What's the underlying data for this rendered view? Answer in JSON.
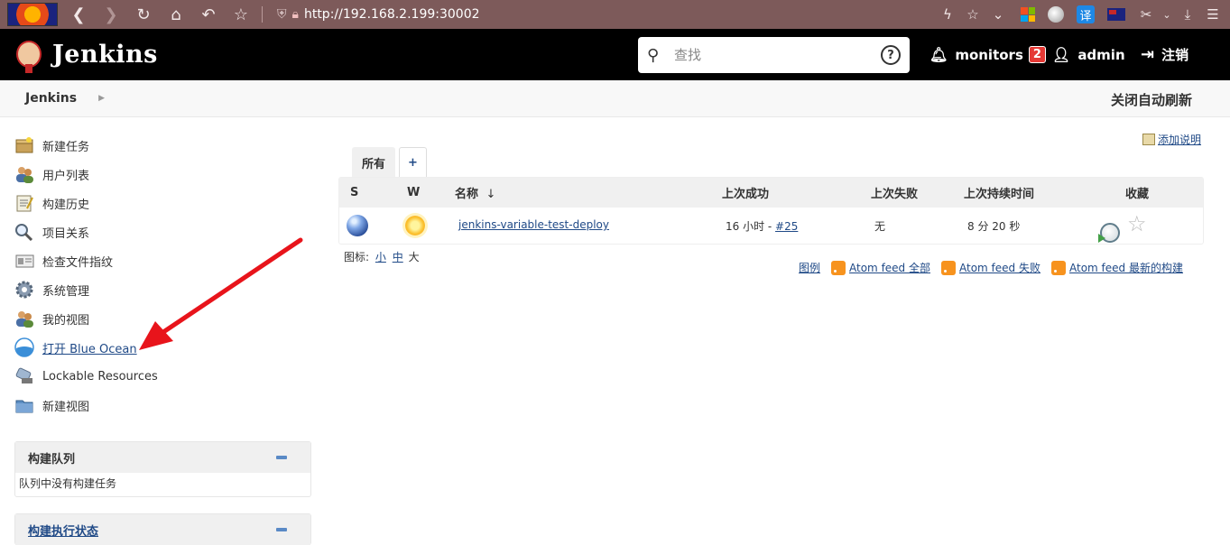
{
  "browser": {
    "url": "http://192.168.2.199:30002",
    "translate_label": "译"
  },
  "header": {
    "app_title": "Jenkins",
    "search_placeholder": "查找",
    "help_label": "?",
    "monitors_label": "monitors",
    "monitors_count": "2",
    "user_label": "admin",
    "logout_label": "注销"
  },
  "breadcrumb": {
    "home": "Jenkins",
    "auto_refresh": "关闭自动刷新"
  },
  "sidebar": {
    "items": [
      {
        "label": "新建任务",
        "icon": "new-job-icon"
      },
      {
        "label": "用户列表",
        "icon": "users-icon"
      },
      {
        "label": "构建历史",
        "icon": "build-history-icon"
      },
      {
        "label": "项目关系",
        "icon": "search-icon"
      },
      {
        "label": "检查文件指纹",
        "icon": "fingerprint-icon"
      },
      {
        "label": "系统管理",
        "icon": "gear-icon"
      },
      {
        "label": "我的视图",
        "icon": "my-views-icon"
      },
      {
        "label": "打开 Blue Ocean",
        "icon": "blue-ocean-icon"
      },
      {
        "label": "Lockable Resources",
        "icon": "lock-resources-icon"
      },
      {
        "label": "新建视图",
        "icon": "folder-icon"
      }
    ],
    "build_queue": {
      "title": "构建队列",
      "empty_text": "队列中没有构建任务"
    },
    "executors": {
      "title": "构建执行状态"
    }
  },
  "main": {
    "add_description": "添加说明",
    "tabs": [
      {
        "label": "所有"
      },
      {
        "label": "+"
      }
    ],
    "table": {
      "headers": {
        "s": "S",
        "w": "W",
        "name": "名称",
        "sort_arrow": "↓",
        "last_success": "上次成功",
        "last_failure": "上次失败",
        "last_duration": "上次持续时间",
        "favorite": "收藏"
      },
      "rows": [
        {
          "name": "jenkins-variable-test-deploy",
          "last_success_text": "16 小时 - ",
          "last_success_build": "#25",
          "last_failure": "无",
          "last_duration": "8 分 20 秒"
        }
      ]
    },
    "icon_size": {
      "label": "图标:",
      "small": "小",
      "medium": "中",
      "large": "大"
    },
    "footer_links": {
      "legend": "图例",
      "feed_all": "Atom feed 全部",
      "feed_failed": "Atom feed 失败",
      "feed_latest": "Atom feed 最新的构建"
    }
  },
  "colors": {
    "header_bg": "#000000",
    "link": "#204a87",
    "badge": "#e53935",
    "annotation_arrow": "#e8141b"
  }
}
